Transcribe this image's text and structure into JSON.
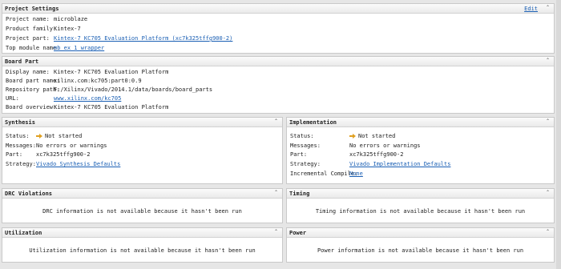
{
  "project_settings": {
    "title": "Project Settings",
    "edit_label": "Edit",
    "rows": [
      {
        "label": "Project name:",
        "value": "microblaze"
      },
      {
        "label": "Product family:",
        "value": "Kintex-7"
      },
      {
        "label": "Project part:",
        "value": "Kintex-7 KC705 Evaluation Platform (xc7k325tffg900-2)"
      },
      {
        "label": "Top module name:",
        "value": "mb_ex_1_wrapper"
      }
    ]
  },
  "board_part": {
    "title": "Board Part",
    "rows": [
      {
        "label": "Display name:",
        "value": "Kintex-7 KC705 Evaluation Platform"
      },
      {
        "label": "Board part name:",
        "value": "xilinx.com:kc705:part0:0.9"
      },
      {
        "label": "Repository path:",
        "value": "F:/Xilinx/Vivado/2014.1/data/boards/board_parts"
      },
      {
        "label": "URL:",
        "value": "www.xilinx.com/kc705"
      },
      {
        "label": "Board overview:",
        "value": "Kintex-7 KC705 Evaluation Platform"
      }
    ]
  },
  "synthesis": {
    "title": "Synthesis",
    "status_label": "Status:",
    "status_value": "Not started",
    "messages_label": "Messages:",
    "messages_value": "No errors or warnings",
    "part_label": "Part:",
    "part_value": "xc7k325tffg900-2",
    "strategy_label": "Strategy:",
    "strategy_value": "Vivado Synthesis Defaults"
  },
  "implementation": {
    "title": "Implementation",
    "status_label": "Status:",
    "status_value": "Not started",
    "messages_label": "Messages:",
    "messages_value": "No errors or warnings",
    "part_label": "Part:",
    "part_value": "xc7k325tffg900-2",
    "strategy_label": "Strategy:",
    "strategy_value": "Vivado Implementation Defaults",
    "incr_label": "Incremental Compile:",
    "incr_value": "None"
  },
  "drc": {
    "title": "DRC Violations",
    "message": "DRC information is not available because it hasn't been run"
  },
  "timing": {
    "title": "Timing",
    "message": "Timing information is not available because it hasn't been run"
  },
  "utilization": {
    "title": "Utilization",
    "message": "Utilization information is not available because it hasn't been run"
  },
  "power": {
    "title": "Power",
    "message": "Power information is not available because it hasn't been run"
  },
  "colors": {
    "link": "#1a5fb4",
    "arrow": "#e0a020"
  },
  "icons": {
    "collapse": "chevron-up-icon",
    "status": "arrow-right-icon"
  }
}
